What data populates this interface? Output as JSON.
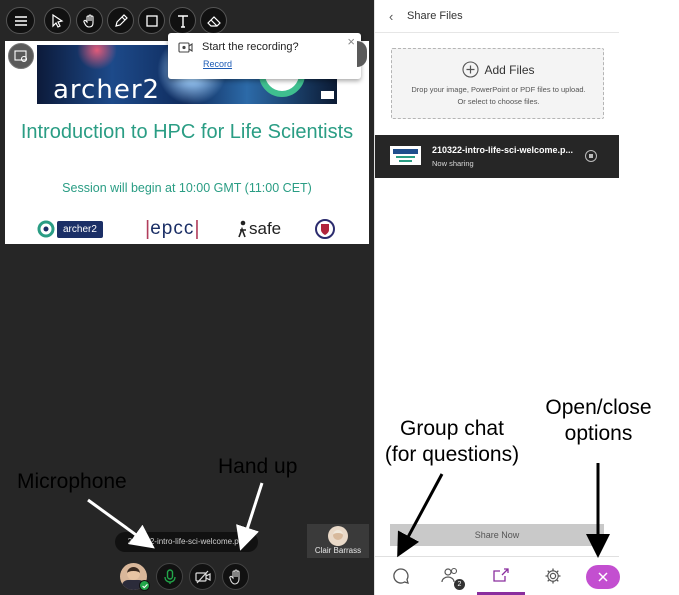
{
  "toolbar": {
    "icons": [
      "menu-icon",
      "pointer-icon",
      "hand-icon",
      "pen-icon",
      "rectangle-icon",
      "text-icon",
      "eraser-icon"
    ]
  },
  "slide": {
    "banner_word": "archer2",
    "title": "Introduction to HPC for Life Scientists",
    "subtitle": "Session will begin at 10:00 GMT (11:00 CET)",
    "logos": {
      "archer2": "archer2",
      "epcc": "epcc",
      "safe": "safe"
    }
  },
  "recording_prompt": {
    "title": "Start the recording?",
    "link": "Record",
    "close": "×"
  },
  "bottom": {
    "filename": "210322-intro-life-sci-welcome.pdf",
    "participant_name": "Clair Barrass",
    "status_color": "#22a64a"
  },
  "panel": {
    "back": "‹",
    "title": "Share Files",
    "add_files": "Add Files",
    "drop_help_line1": "Drop your image, PowerPoint or PDF files to upload.",
    "drop_help_line2": "Or select to choose files.",
    "file": {
      "name": "210322-intro-life-sci-welcome.p...",
      "status": "Now sharing"
    },
    "share_now": "Share Now",
    "tabs": [
      "chat-icon",
      "attendees-icon",
      "share-content-icon",
      "settings-icon",
      "close-icon"
    ],
    "attendee_count": "2",
    "accent_color": "#8a2e9e"
  },
  "annotations": {
    "microphone": "Microphone",
    "hand_up": "Hand up",
    "group_chat_line1": "Group chat",
    "group_chat_line2": "(for questions)",
    "options_line1": "Open/close",
    "options_line2": "options"
  }
}
